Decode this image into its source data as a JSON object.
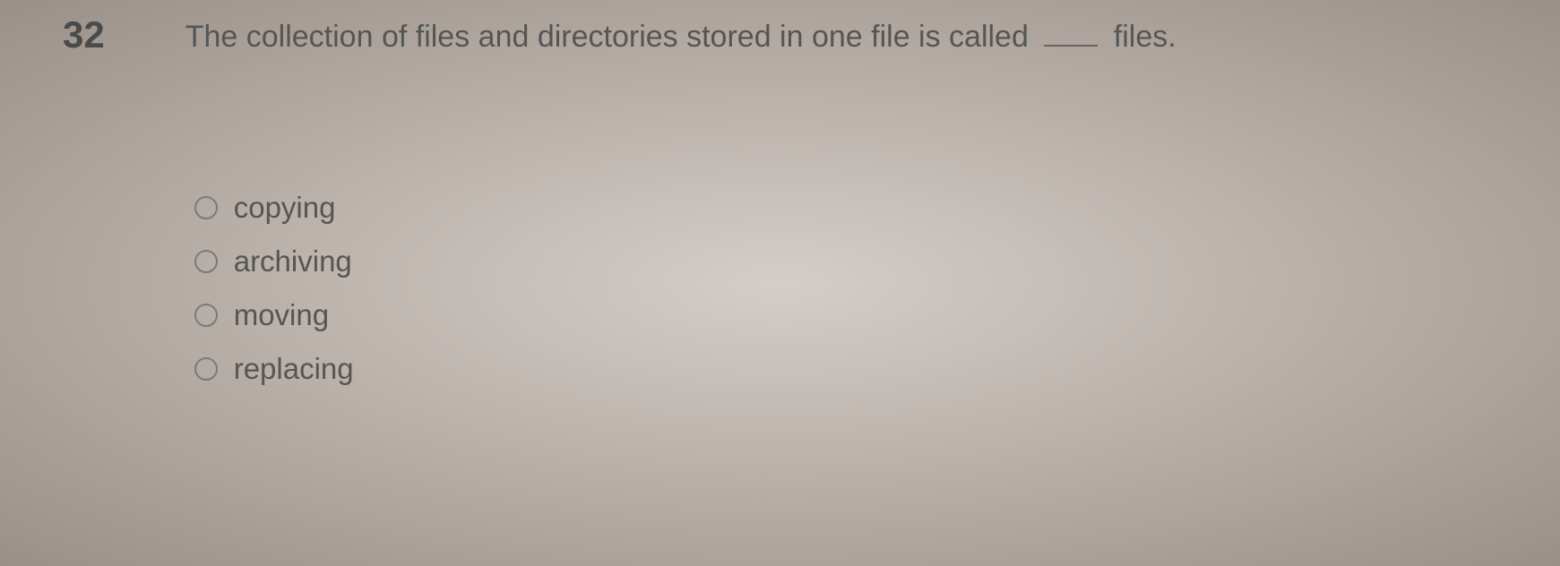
{
  "question": {
    "number": "32",
    "text_before": "The collection of files and directories stored in one file is called",
    "text_after": "files."
  },
  "options": [
    {
      "label": "copying"
    },
    {
      "label": "archiving"
    },
    {
      "label": "moving"
    },
    {
      "label": "replacing"
    }
  ]
}
